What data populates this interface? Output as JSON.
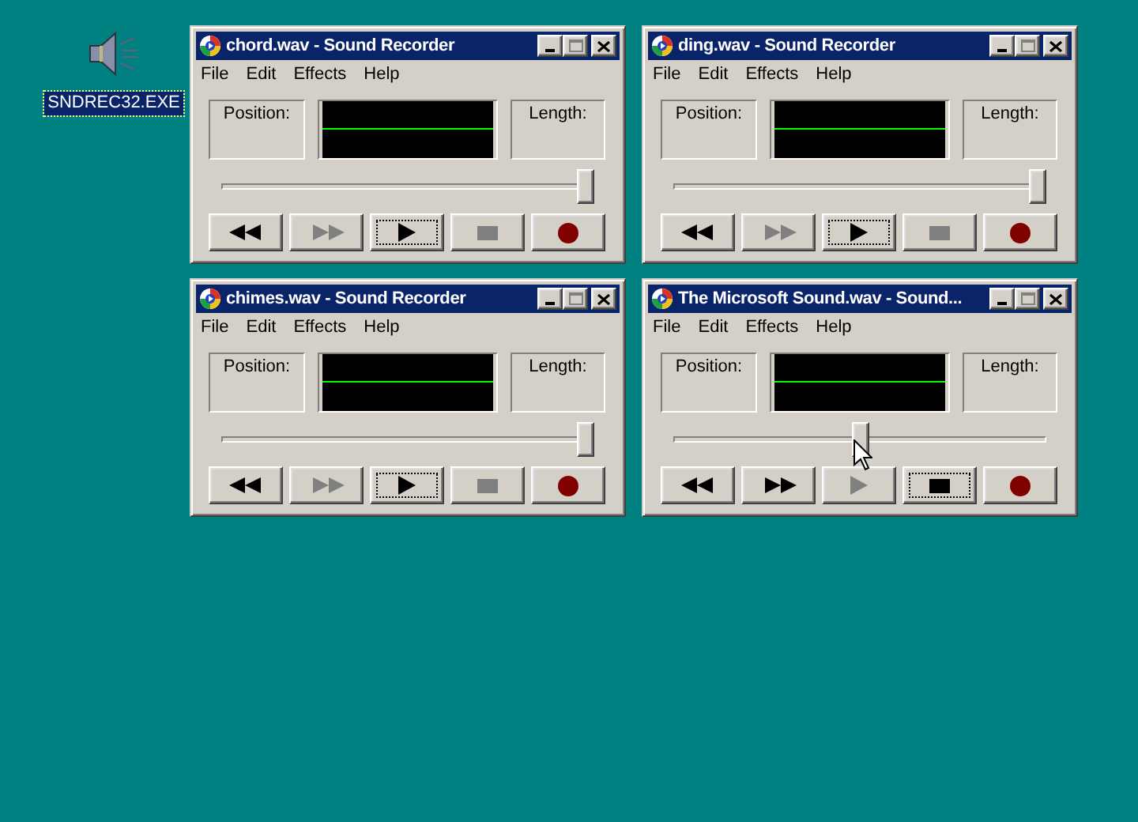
{
  "desktop_icon": {
    "label": "SNDREC32.EXE",
    "selected": true
  },
  "windows": [
    {
      "title": "chord.wav - Sound Recorder",
      "menu": [
        {
          "label": "File"
        },
        {
          "label": "Edit"
        },
        {
          "label": "Effects"
        },
        {
          "label": "Help"
        }
      ],
      "position_label": "Position:",
      "length_label": "Length:",
      "slider": {
        "level": 1
      },
      "buttons": [
        {
          "kind": "rewind",
          "disabled": false,
          "focused": false
        },
        {
          "kind": "forward",
          "disabled": true,
          "focused": false
        },
        {
          "kind": "play",
          "disabled": false,
          "focused": true
        },
        {
          "kind": "stop",
          "disabled": true,
          "focused": false
        },
        {
          "kind": "record",
          "disabled": false,
          "focused": false
        }
      ]
    },
    {
      "title": "ding.wav - Sound Recorder",
      "menu": [
        {
          "label": "File"
        },
        {
          "label": "Edit"
        },
        {
          "label": "Effects"
        },
        {
          "label": "Help"
        }
      ],
      "position_label": "Position:",
      "length_label": "Length:",
      "slider": {
        "level": 1
      },
      "buttons": [
        {
          "kind": "rewind",
          "disabled": false,
          "focused": false
        },
        {
          "kind": "forward",
          "disabled": true,
          "focused": false
        },
        {
          "kind": "play",
          "disabled": false,
          "focused": true
        },
        {
          "kind": "stop",
          "disabled": true,
          "focused": false
        },
        {
          "kind": "record",
          "disabled": false,
          "focused": false
        }
      ]
    },
    {
      "title": "chimes.wav - Sound Recorder",
      "menu": [
        {
          "label": "File"
        },
        {
          "label": "Edit"
        },
        {
          "label": "Effects"
        },
        {
          "label": "Help"
        }
      ],
      "position_label": "Position:",
      "length_label": "Length:",
      "slider": {
        "level": 1
      },
      "buttons": [
        {
          "kind": "rewind",
          "disabled": false,
          "focused": false
        },
        {
          "kind": "forward",
          "disabled": true,
          "focused": false
        },
        {
          "kind": "play",
          "disabled": false,
          "focused": true
        },
        {
          "kind": "stop",
          "disabled": true,
          "focused": false
        },
        {
          "kind": "record",
          "disabled": false,
          "focused": false
        }
      ]
    },
    {
      "title": "The Microsoft Sound.wav - Sound...",
      "menu": [
        {
          "label": "File"
        },
        {
          "label": "Edit"
        },
        {
          "label": "Effects"
        },
        {
          "label": "Help"
        }
      ],
      "position_label": "Position:",
      "length_label": "Length:",
      "slider": {
        "level": 0.5
      },
      "buttons": [
        {
          "kind": "rewind",
          "disabled": false,
          "focused": false
        },
        {
          "kind": "forward",
          "disabled": false,
          "focused": false
        },
        {
          "kind": "play",
          "disabled": true,
          "focused": false
        },
        {
          "kind": "stop",
          "disabled": false,
          "focused": true
        },
        {
          "kind": "record",
          "disabled": false,
          "focused": false
        }
      ]
    }
  ]
}
